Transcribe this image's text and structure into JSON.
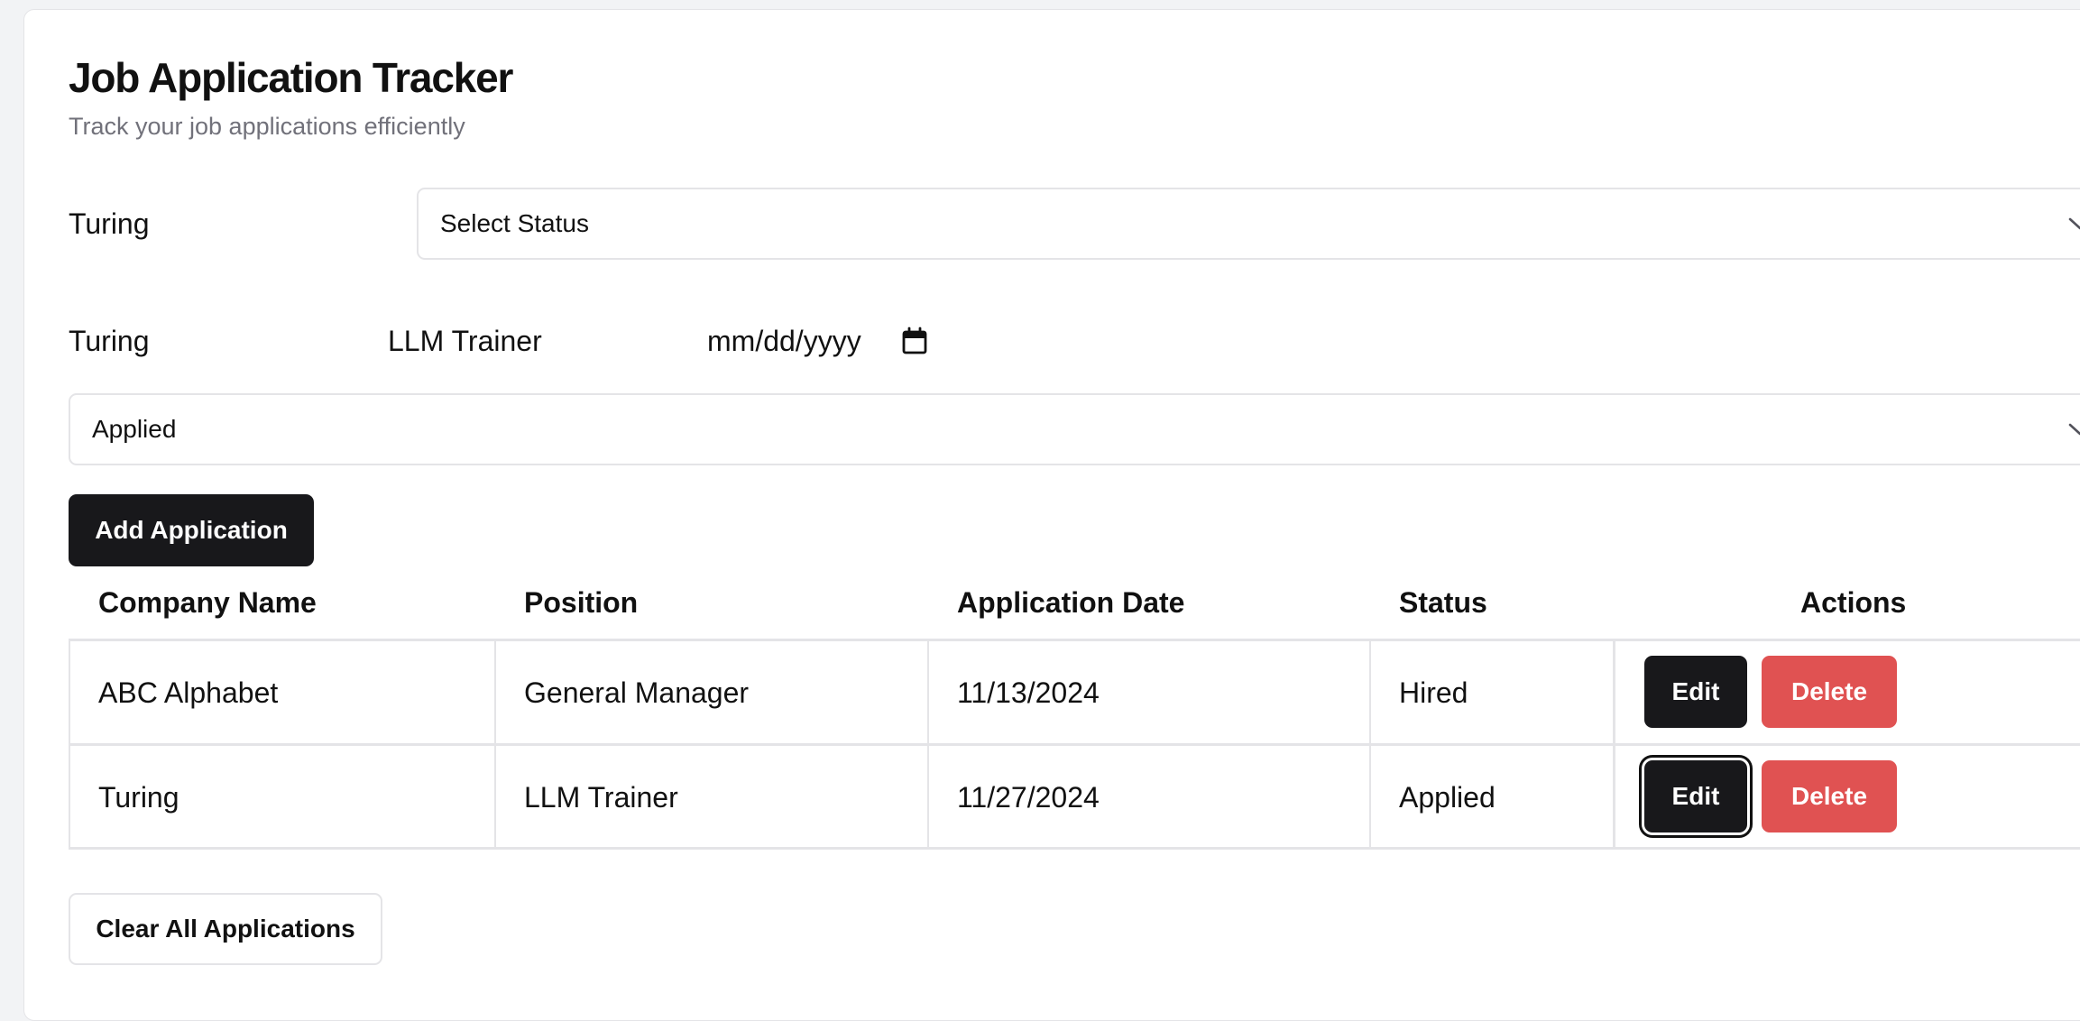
{
  "header": {
    "title": "Job Application Tracker",
    "subtitle": "Track your job applications efficiently"
  },
  "filter": {
    "company_text": "Turing",
    "status_select": {
      "value": "Select Status",
      "icon": "chevron-down-icon"
    }
  },
  "form": {
    "company_value": "Turing",
    "position_value": "LLM Trainer",
    "date_placeholder": "mm/dd/yyyy",
    "date_icon": "calendar-icon",
    "status_select": {
      "value": "Applied",
      "icon": "chevron-down-icon"
    },
    "add_button_label": "Add Application"
  },
  "table": {
    "headers": {
      "company": "Company Name",
      "position": "Position",
      "date": "Application Date",
      "status": "Status",
      "actions": "Actions"
    },
    "rows": [
      {
        "company": "ABC Alphabet",
        "position": "General Manager",
        "date": "11/13/2024",
        "status": "Hired",
        "edit_label": "Edit",
        "delete_label": "Delete"
      },
      {
        "company": "Turing",
        "position": "LLM Trainer",
        "date": "11/27/2024",
        "status": "Applied",
        "edit_label": "Edit",
        "delete_label": "Delete"
      }
    ]
  },
  "footer": {
    "clear_button_label": "Clear All Applications"
  },
  "colors": {
    "primary_button": "#18181b",
    "danger_button": "#e05252",
    "border": "#e4e4e7",
    "muted_text": "#71717a",
    "page_background": "#f2f3f5"
  }
}
